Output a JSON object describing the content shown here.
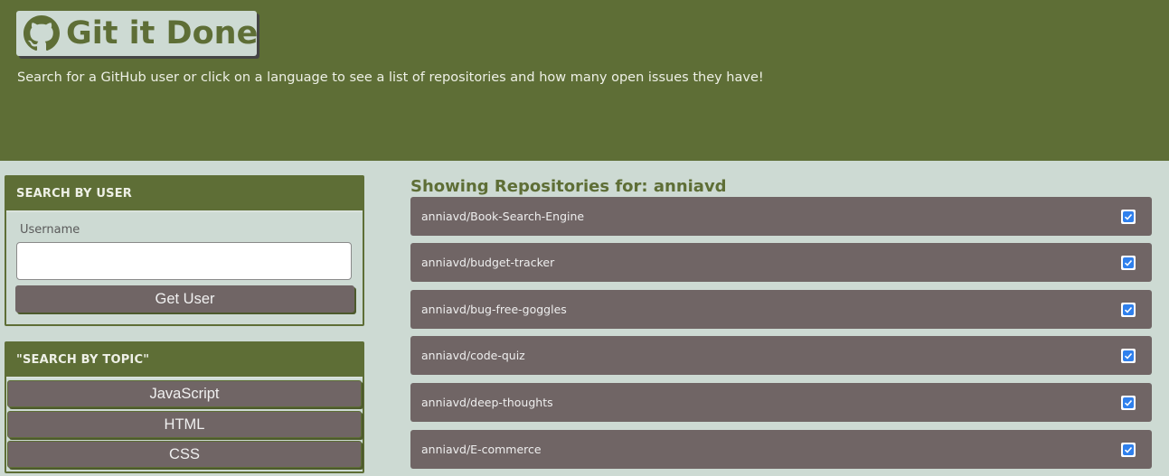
{
  "header": {
    "title": "Git it Done!",
    "icon": "github-icon",
    "subtitle": "Search for a GitHub user or click on a language to see a list of repositories and how many open issues they have!"
  },
  "user_search": {
    "heading": "SEARCH BY USER",
    "field_label": "Username",
    "input_value": "",
    "button_label": "Get User"
  },
  "topic_search": {
    "heading": "\"SEARCH BY TOPIC\"",
    "buttons": [
      "JavaScript",
      "HTML",
      "CSS"
    ]
  },
  "repos": {
    "heading": "Showing Repositories for: anniavd",
    "items": [
      {
        "name": "anniavd/Book-Search-Engine",
        "status_icon": "checkbox-checked-icon"
      },
      {
        "name": "anniavd/budget-tracker",
        "status_icon": "checkbox-checked-icon"
      },
      {
        "name": "anniavd/bug-free-goggles",
        "status_icon": "checkbox-checked-icon"
      },
      {
        "name": "anniavd/code-quiz",
        "status_icon": "checkbox-checked-icon"
      },
      {
        "name": "anniavd/deep-thoughts",
        "status_icon": "checkbox-checked-icon"
      },
      {
        "name": "anniavd/E-commerce",
        "status_icon": "checkbox-checked-icon"
      }
    ]
  },
  "colors": {
    "primary": "#5e6e36",
    "background": "#cddad3",
    "card": "#706565",
    "check": "#2f80ed"
  }
}
